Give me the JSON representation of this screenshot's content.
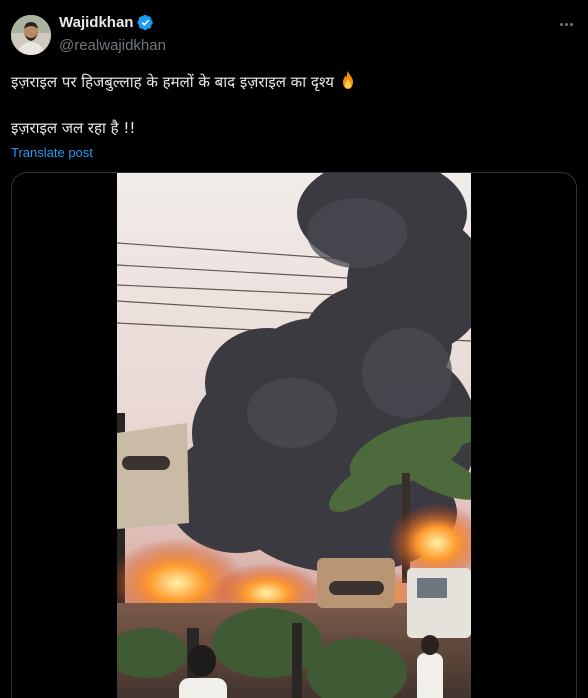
{
  "author": {
    "display_name": "Wajidkhan",
    "handle": "@realwajidkhan",
    "verified": true,
    "avatar_icon": "profile-photo"
  },
  "post": {
    "line1": "इज़राइल पर हिजबुल्लाह के हमलों के बाद इज़राइल का दृश्य",
    "line1_emoji": "fire-icon",
    "line2": "इज़राइल जल रहा है !!",
    "translate_label": "Translate post"
  },
  "media": {
    "type": "video",
    "scene_icon": "burning-street-video-thumbnail"
  },
  "colors": {
    "background": "#000000",
    "text_primary": "#e7e9ea",
    "text_secondary": "#71767b",
    "link": "#1d9bf0",
    "border": "#2f3336",
    "verified_badge": "#1d9bf0"
  }
}
